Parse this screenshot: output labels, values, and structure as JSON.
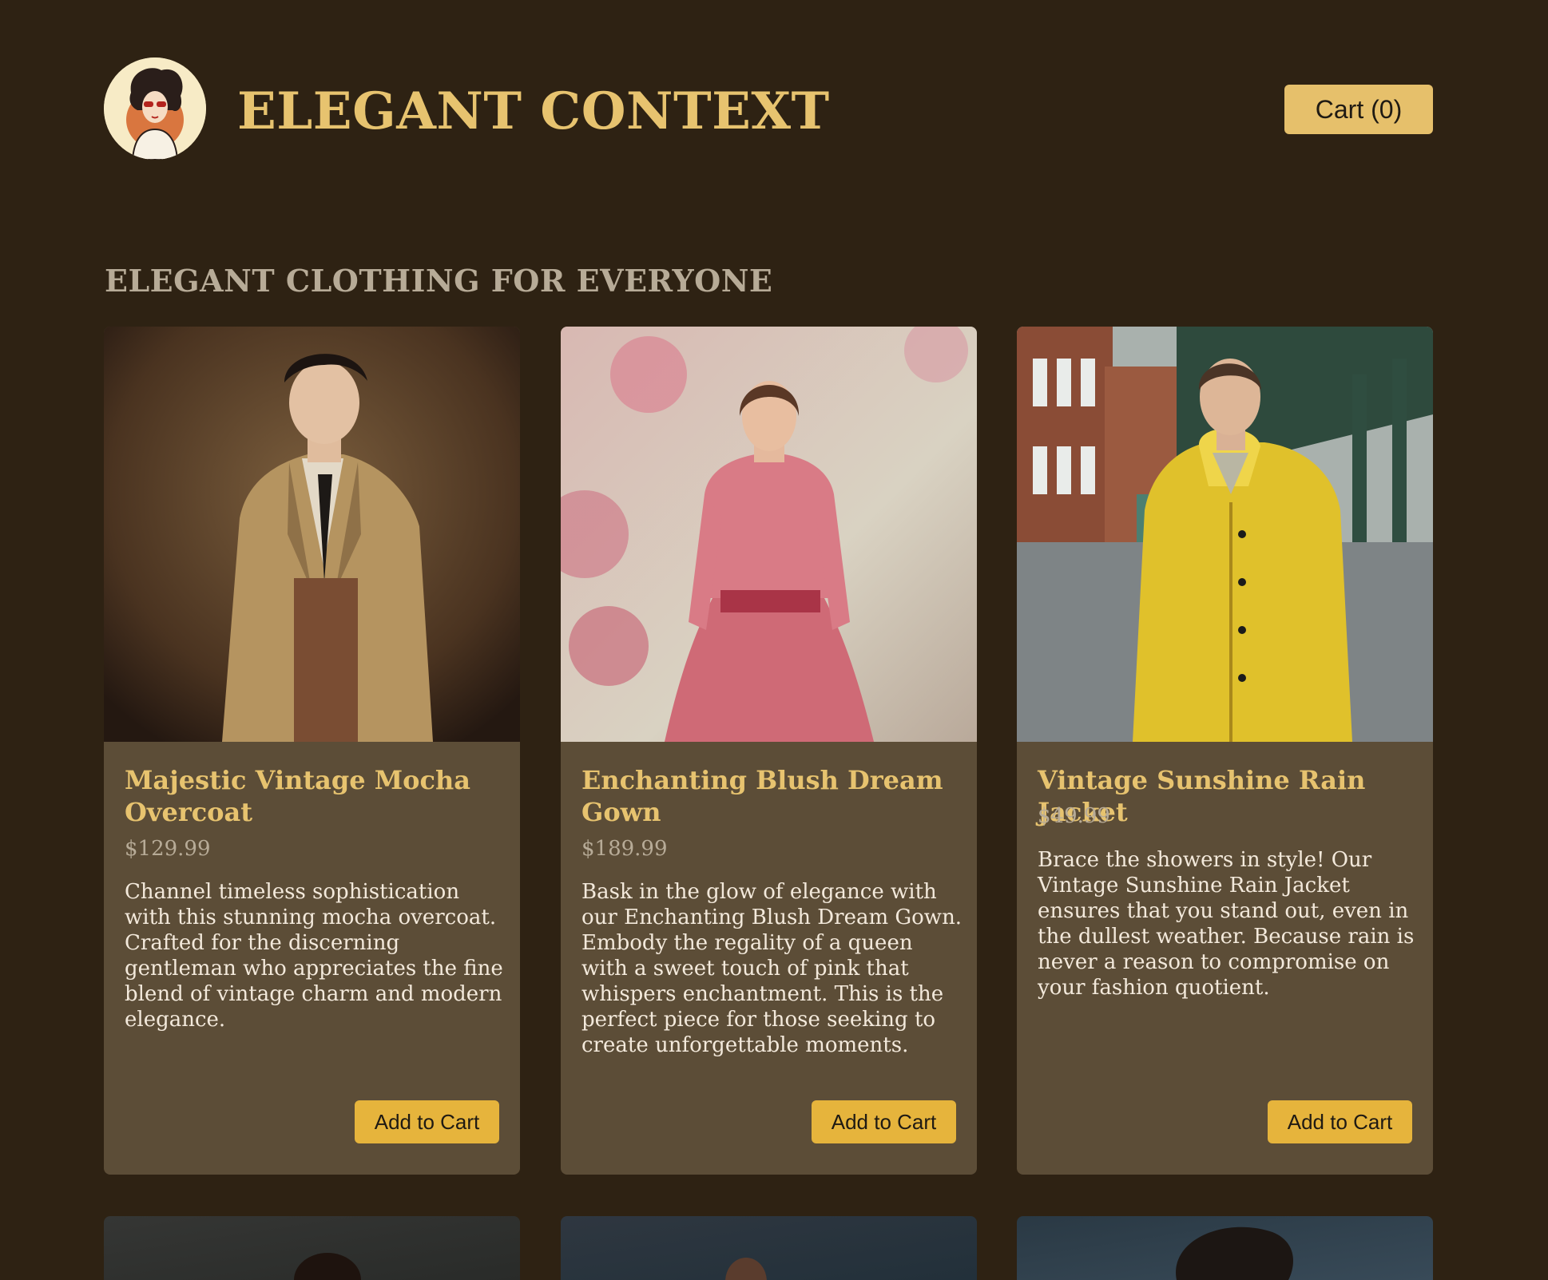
{
  "header": {
    "brand": "ELEGANT CONTEXT",
    "cart_label": "Cart (0)",
    "logo_icon": "vintage-woman-portrait-logo"
  },
  "section": {
    "title": "ELEGANT CLOTHING FOR EVERYONE"
  },
  "products": [
    {
      "name": "Majestic Vintage Mocha Overcoat",
      "price": "$129.99",
      "description": "Channel timeless sophistication with this stunning mocha overcoat. Crafted for the discerning gentleman who appreciates the fine blend of vintage charm and modern elegance.",
      "button": "Add to Cart",
      "image": "man-in-mocha-trench-coat-photo"
    },
    {
      "name": "Enchanting Blush Dream Gown",
      "price": "$189.99",
      "description": "Bask in the glow of elegance with our Enchanting Blush Dream Gown. Embody the regality of a queen with a sweet touch of pink that whispers enchantment. This is the perfect piece for those seeking to create unforgettable moments.",
      "button": "Add to Cart",
      "image": "woman-in-pink-gown-photo"
    },
    {
      "name": "Vintage Sunshine Rain Jacket",
      "price": "$49.99",
      "description": "Brace the showers in style! Our Vintage Sunshine Rain Jacket ensures that you stand out, even in the dullest weather. Because rain is never a reason to compromise on your fashion quotient.",
      "button": "Add to Cart",
      "image": "man-in-yellow-raincoat-photo"
    }
  ],
  "colors": {
    "background": "#2e2213",
    "card": "#5c4d37",
    "accent": "#e7c36f",
    "button": "#e6b43c"
  }
}
